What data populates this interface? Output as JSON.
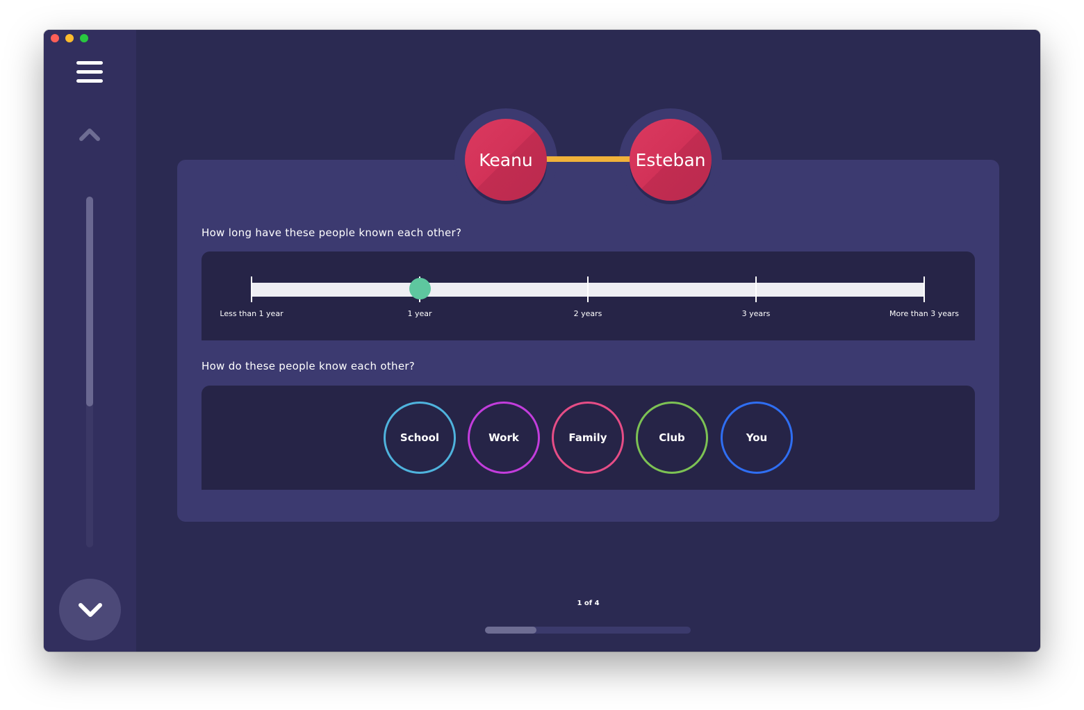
{
  "window": {
    "traffic_lights": [
      "close",
      "minimize",
      "zoom"
    ]
  },
  "sidebar": {
    "menu_icon": "hamburger-menu-icon",
    "up_icon": "chevron-up-icon",
    "down_icon": "chevron-down-icon"
  },
  "people": {
    "left": "Keanu",
    "right": "Esteban"
  },
  "questions": {
    "duration": {
      "prompt": "How long have these people known each other?",
      "labels": [
        "Less than 1 year",
        "1 year",
        "2 years",
        "3 years",
        "More than 3 years"
      ],
      "selected_index": 1
    },
    "relation": {
      "prompt": "How do these people know each other?",
      "options": [
        {
          "label": "School",
          "color": "#4fb3dd"
        },
        {
          "label": "Work",
          "color": "#c23ddc"
        },
        {
          "label": "Family",
          "color": "#e64d86"
        },
        {
          "label": "Club",
          "color": "#7dc254"
        },
        {
          "label": "You",
          "color": "#2f6ef2"
        }
      ]
    }
  },
  "pagination": {
    "text": "1 of 4",
    "current": 1,
    "total": 4
  },
  "colors": {
    "background": "#2b2a52",
    "card": "#3c3a70",
    "panel": "#262447",
    "avatar": "#d2355a",
    "connector": "#f0b23a",
    "slider_thumb": "#5ec79f"
  }
}
